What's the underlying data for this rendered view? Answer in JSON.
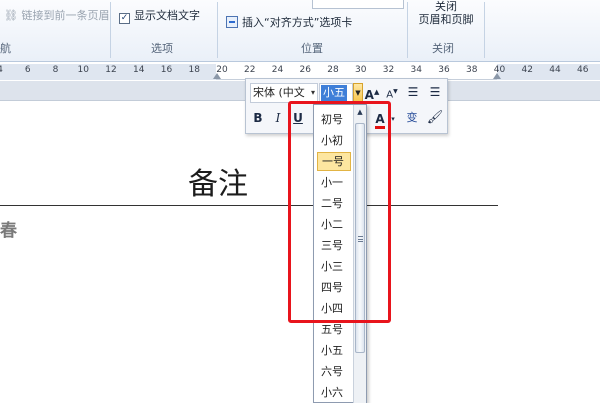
{
  "ribbon": {
    "link_previous": "链接到前一条页眉",
    "show_doc_text": "显示文档文字",
    "show_doc_text_checked": true,
    "insert_align_tab": "插入“对齐方式”选项卡",
    "close_line1": "关闭",
    "close_line2": "页眉和页脚",
    "group_nav_partial": "航",
    "group_options": "选项",
    "group_position": "位置",
    "group_close": "关闭"
  },
  "ruler": {
    "ticks": [
      "4",
      "6",
      "8",
      "10",
      "12",
      "14",
      "16",
      "18",
      "20",
      "22",
      "24",
      "26",
      "28",
      "30",
      "32",
      "34",
      "36",
      "38",
      "40",
      "42",
      "44",
      "46"
    ]
  },
  "document": {
    "title": "备注",
    "side_text": "春"
  },
  "mini_toolbar": {
    "font_name": "宋体 (中文",
    "font_size": "小五",
    "grow_font": "A",
    "shrink_font": "A",
    "bold": "B",
    "italic": "I",
    "underline": "U",
    "font_color_letter": "A",
    "phonetic": "变"
  },
  "font_size_list": {
    "items": [
      "初号",
      "小初",
      "一号",
      "小一",
      "二号",
      "小二",
      "三号",
      "小三",
      "四号",
      "小四",
      "五号",
      "小五",
      "六号",
      "小六"
    ],
    "selected": "一号"
  },
  "colors": {
    "highlight": "#e8141c",
    "selection_bg": "#fde6a0",
    "font_color_bar": "#e01010",
    "active_size_bg": "#3f7fd8"
  }
}
